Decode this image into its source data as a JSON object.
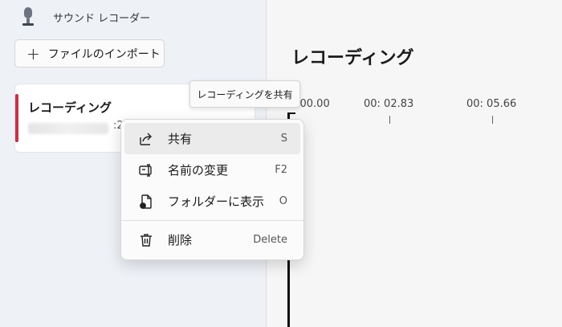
{
  "app": {
    "title": "サウンド レコーダー"
  },
  "sidebar": {
    "import_label": "ファイルのインポート",
    "recording": {
      "title": "レコーディング",
      "duration_tail": ":2"
    }
  },
  "main": {
    "title": "レコーディング",
    "timeline": [
      ": 00.00",
      "00: 02.83",
      "00: 05.66"
    ]
  },
  "tooltip": "レコーディングを共有",
  "context_menu": {
    "items": [
      {
        "label": "共有",
        "shortcut": "S",
        "icon": "share-icon"
      },
      {
        "label": "名前の変更",
        "shortcut": "F2",
        "icon": "rename-icon"
      },
      {
        "label": "フォルダーに表示",
        "shortcut": "O",
        "icon": "folder-file-icon"
      },
      {
        "label": "削除",
        "shortcut": "Delete",
        "icon": "trash-icon"
      }
    ]
  },
  "colors": {
    "accent": "#c4314b",
    "hover": "#ebebeb"
  }
}
